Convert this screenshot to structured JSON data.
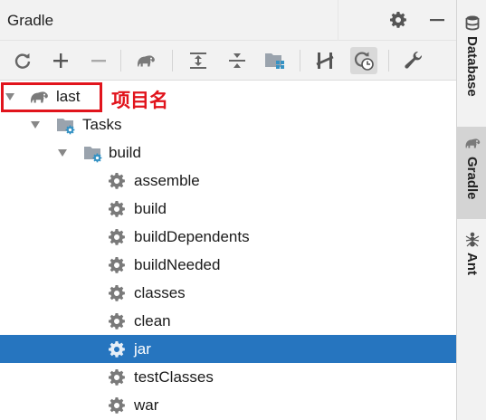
{
  "panel": {
    "title": "Gradle",
    "settings_icon": "gear-icon",
    "hide_icon": "minus-icon"
  },
  "toolbar": {
    "buttons": [
      {
        "name": "reload-button",
        "icon": "refresh-icon"
      },
      {
        "name": "add-button",
        "icon": "plus-icon"
      },
      {
        "name": "remove-button",
        "icon": "minus-icon"
      },
      {
        "name": "execute-task-button",
        "icon": "gradle-elephant-icon"
      },
      {
        "name": "expand-all-button",
        "icon": "expand-all-icon"
      },
      {
        "name": "collapse-all-button",
        "icon": "collapse-all-icon"
      },
      {
        "name": "group-modules-button",
        "icon": "folder-modules-icon"
      },
      {
        "name": "toggle-offline-button",
        "icon": "offline-icon"
      },
      {
        "name": "show-dependencies-button",
        "icon": "dependencies-clock-icon"
      },
      {
        "name": "build-settings-button",
        "icon": "wrench-icon"
      }
    ]
  },
  "tree": {
    "project": {
      "label": "last",
      "icon": "gradle-elephant-icon",
      "expanded": true
    },
    "tasks_folder": {
      "label": "Tasks",
      "icon": "task-folder-icon",
      "expanded": true
    },
    "build_group": {
      "label": "build",
      "icon": "task-folder-icon",
      "expanded": true
    },
    "tasks": [
      {
        "label": "assemble",
        "icon": "gear-icon",
        "selected": false
      },
      {
        "label": "build",
        "icon": "gear-icon",
        "selected": false
      },
      {
        "label": "buildDependents",
        "icon": "gear-icon",
        "selected": false
      },
      {
        "label": "buildNeeded",
        "icon": "gear-icon",
        "selected": false
      },
      {
        "label": "classes",
        "icon": "gear-icon",
        "selected": false
      },
      {
        "label": "clean",
        "icon": "gear-icon",
        "selected": false
      },
      {
        "label": "jar",
        "icon": "gear-icon",
        "selected": true
      },
      {
        "label": "testClasses",
        "icon": "gear-icon",
        "selected": false
      },
      {
        "label": "war",
        "icon": "gear-icon",
        "selected": false
      }
    ]
  },
  "annotation": {
    "text": "项目名",
    "color": "#e1141c"
  },
  "side_stripe": {
    "tabs": [
      {
        "label": "Database",
        "icon": "database-icon",
        "active": false
      },
      {
        "label": "Gradle",
        "icon": "gradle-elephant-icon",
        "active": true
      },
      {
        "label": "Ant",
        "icon": "ant-icon",
        "active": false
      }
    ]
  },
  "colors": {
    "selection": "#2675bf",
    "toolbar_bg": "#f2f2f2",
    "icon_gray": "#6e6e6e",
    "icon_blue": "#3592c4"
  }
}
